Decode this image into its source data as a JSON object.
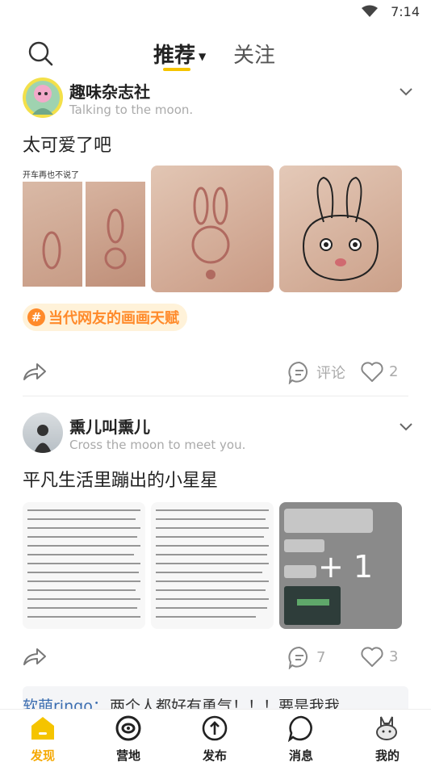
{
  "status_bar": {
    "time": "7:14"
  },
  "header": {
    "tabs": [
      {
        "label": "推荐",
        "active": true
      },
      {
        "label": "关注",
        "active": false
      }
    ]
  },
  "posts": [
    {
      "author": "趣味杂志社",
      "signature": "Talking to the moon.",
      "title": "太可爱了吧",
      "image_caption": "开车再也不说了",
      "tag": "当代网友的画画天赋",
      "actions": {
        "comment_label": "评论",
        "like_count": "2"
      }
    },
    {
      "author": "熏儿叫熏儿",
      "signature": "Cross the moon to meet you.",
      "title": "平凡生活里蹦出的小星星",
      "image_more": "+ 1",
      "actions": {
        "comment_count": "7",
        "like_count": "3"
      }
    }
  ],
  "comment_preview": {
    "name": "软萌ringo：",
    "text": "两个人都好有勇气！！！要是我我"
  },
  "bottom_nav": [
    {
      "label": "发现",
      "icon": "discover-icon",
      "active": true
    },
    {
      "label": "营地",
      "icon": "camp-icon",
      "active": false
    },
    {
      "label": "发布",
      "icon": "publish-icon",
      "active": false
    },
    {
      "label": "消息",
      "icon": "message-icon",
      "active": false
    },
    {
      "label": "我的",
      "icon": "profile-icon",
      "active": false
    }
  ],
  "colors": {
    "accent": "#f5c400",
    "tag_text": "#ff8a2a",
    "comment_name": "#3b6db0"
  }
}
